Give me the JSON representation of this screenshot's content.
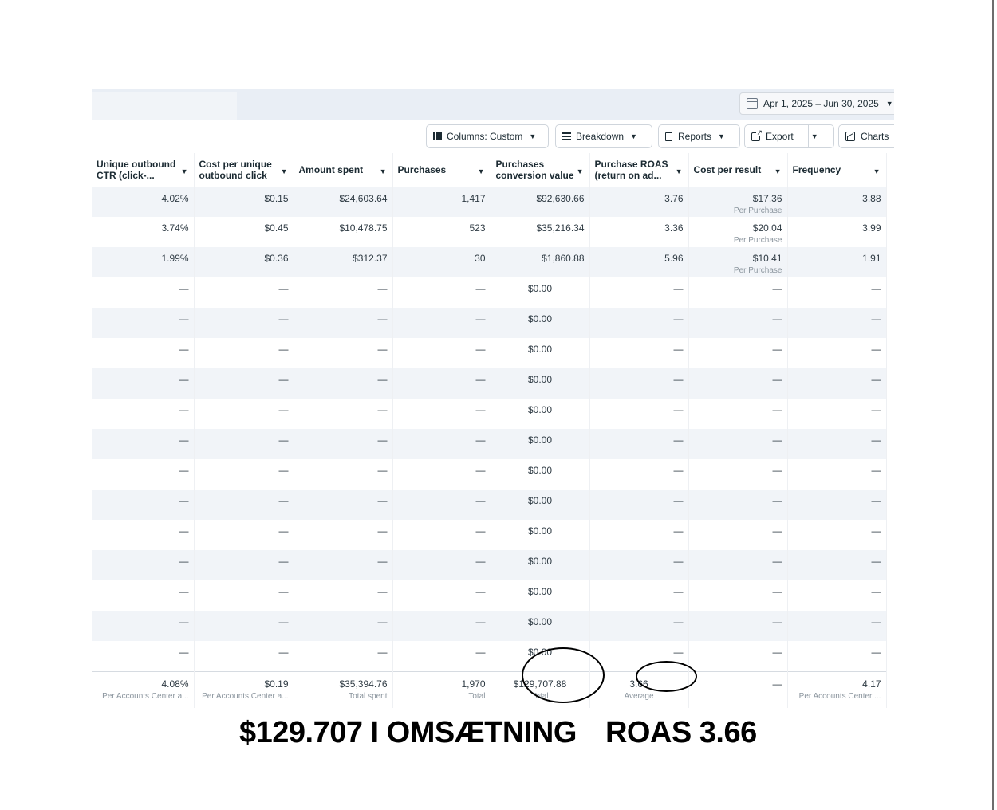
{
  "date_range": {
    "label": "Apr 1, 2025 – Jun 30, 2025"
  },
  "toolbar": {
    "columns_label": "Columns: Custom",
    "breakdown_label": "Breakdown",
    "reports_label": "Reports",
    "export_label": "Export",
    "charts_label": "Charts"
  },
  "columns": [
    "Unique outbound CTR (click-...",
    "Cost per unique outbound click",
    "Amount spent",
    "Purchases",
    "Purchases conversion value",
    "Purchase ROAS (return on ad...",
    "Cost per result",
    "Frequency"
  ],
  "rows": [
    {
      "ctr": "4.02%",
      "cpc": "$0.15",
      "spent": "$24,603.64",
      "purchases": "1,417",
      "value": "$92,630.66",
      "roas": "3.76",
      "cpr": "$17.36",
      "cpr_sub": "Per Purchase",
      "freq": "3.88"
    },
    {
      "ctr": "3.74%",
      "cpc": "$0.45",
      "spent": "$10,478.75",
      "purchases": "523",
      "value": "$35,216.34",
      "roas": "3.36",
      "cpr": "$20.04",
      "cpr_sub": "Per Purchase",
      "freq": "3.99"
    },
    {
      "ctr": "1.99%",
      "cpc": "$0.36",
      "spent": "$312.37",
      "purchases": "30",
      "value": "$1,860.88",
      "roas": "5.96",
      "cpr": "$10.41",
      "cpr_sub": "Per Purchase",
      "freq": "1.91"
    }
  ],
  "empty_rows": {
    "dash": "—",
    "value": "$0.00",
    "count": 13
  },
  "totals": {
    "ctr": "4.08%",
    "ctr_sub": "Per Accounts Center a...",
    "cpc": "$0.19",
    "cpc_sub": "Per Accounts Center a...",
    "spent": "$35,394.76",
    "spent_sub": "Total spent",
    "purchases": "1,970",
    "purchases_sub": "Total",
    "value": "$129,707.88",
    "value_sub": "Total",
    "roas": "3.66",
    "roas_sub": "Average",
    "cpr": "—",
    "freq": "4.17",
    "freq_sub": "Per Accounts Center ..."
  },
  "caption": {
    "revenue": "$129.707 I OMSÆTNING",
    "roas": "ROAS 3.66"
  }
}
